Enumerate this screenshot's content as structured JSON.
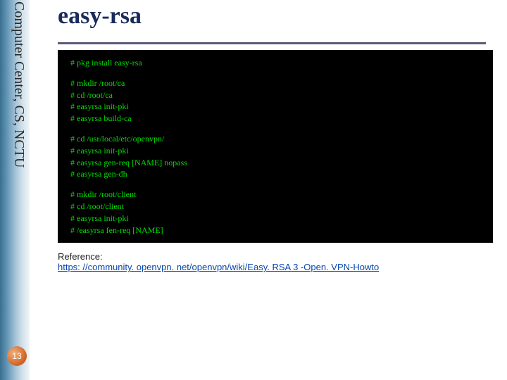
{
  "sidebar": {
    "text": "Computer Center, CS, NCTU"
  },
  "page_number": "13",
  "title": "easy-rsa",
  "terminal": {
    "blocks": [
      {
        "lines": [
          "# pkg install easy-rsa"
        ]
      },
      {
        "lines": [
          "# mkdir /root/ca",
          "# cd /root/ca",
          "# easyrsa init-pki",
          "# easyrsa build-ca"
        ]
      },
      {
        "lines": [
          "# cd /usr/local/etc/openvpn/",
          "# easyrsa init-pki",
          "# easyrsa gen-req [NAME] nopass",
          "# easyrsa gen-dh"
        ]
      },
      {
        "lines": [
          "# mkdir /root/client",
          "# cd /root/client",
          "# easyrsa init-pki",
          "# /easyrsa fen-req [NAME]"
        ]
      }
    ]
  },
  "reference": {
    "label": "Reference:",
    "link_text": "https: //community. openvpn. net/openvpn/wiki/Easy. RSA 3 -Open. VPN-Howto",
    "link_href": "https://community.openvpn.net/openvpn/wiki/EasyRSA3-OpenVPN-Howto"
  }
}
